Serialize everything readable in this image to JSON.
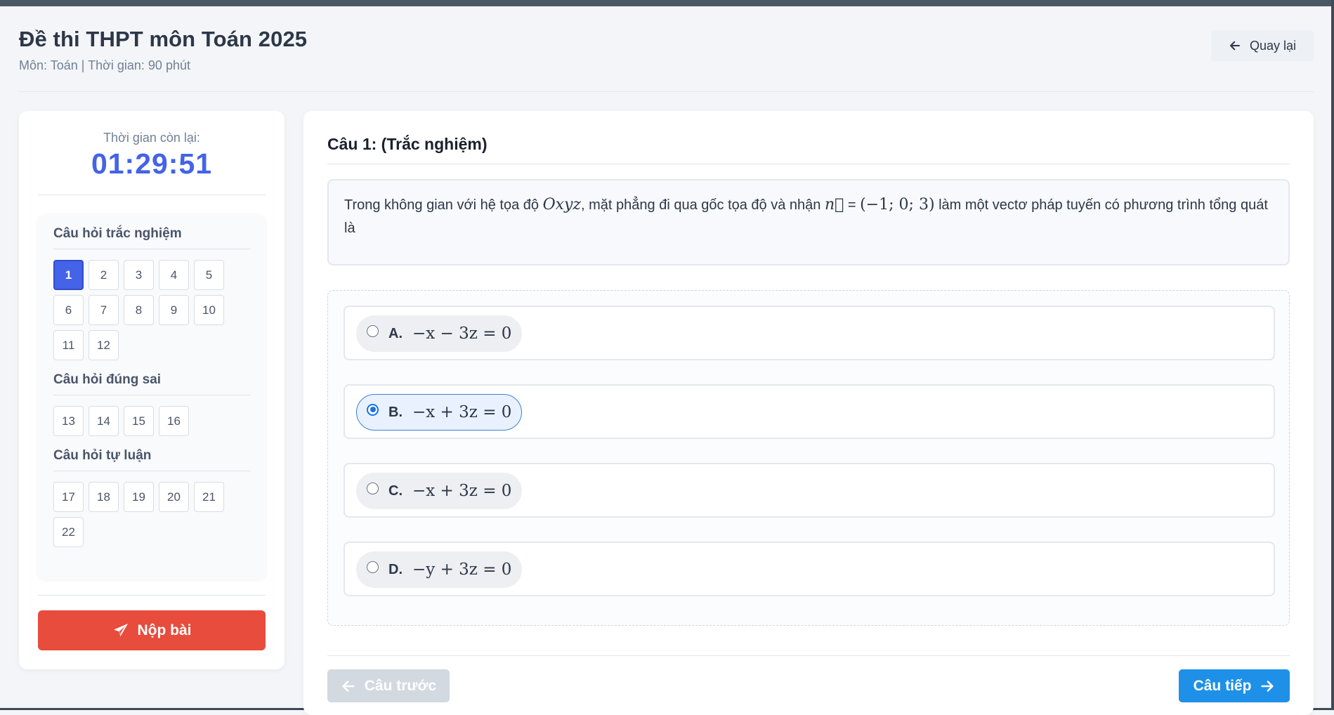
{
  "header": {
    "title": "Đề thi THPT môn Toán 2025",
    "subtitle": "Môn: Toán | Thời gian: 90 phút",
    "back_label": "Quay lại"
  },
  "sidebar": {
    "timer_label": "Thời gian còn lại:",
    "timer_value": "01:29:51",
    "sections": [
      {
        "title": "Câu hỏi trắc nghiệm",
        "questions": [
          "1",
          "2",
          "3",
          "4",
          "5",
          "6",
          "7",
          "8",
          "9",
          "10",
          "11",
          "12"
        ]
      },
      {
        "title": "Câu hỏi đúng sai",
        "questions": [
          "13",
          "14",
          "15",
          "16"
        ]
      },
      {
        "title": "Câu hỏi tự luận",
        "questions": [
          "17",
          "18",
          "19",
          "20",
          "21",
          "22"
        ]
      }
    ],
    "active_question": "1",
    "submit_label": "Nộp bài"
  },
  "question": {
    "title": "Câu 1: (Trắc nghiệm)",
    "text_1": "Trong không gian với hệ tọa độ ",
    "math_1": "Oxyz",
    "text_2": ", mặt phẳng đi qua gốc tọa độ và nhận ",
    "math_2": "n⃗",
    "text_3": " = ",
    "math_3": "(−1; 0; 3)",
    "text_4": " làm một vectơ pháp tuyến có phương trình tổng quát là",
    "options": [
      {
        "letter": "A.",
        "text": "−x − 3z = 0"
      },
      {
        "letter": "B.",
        "text": "−x + 3z = 0"
      },
      {
        "letter": "C.",
        "text": "−x + 3z = 0"
      },
      {
        "letter": "D.",
        "text": "−y + 3z = 0"
      }
    ],
    "selected_option": "B."
  },
  "nav": {
    "prev_label": "Câu trước",
    "next_label": "Câu tiếp"
  }
}
